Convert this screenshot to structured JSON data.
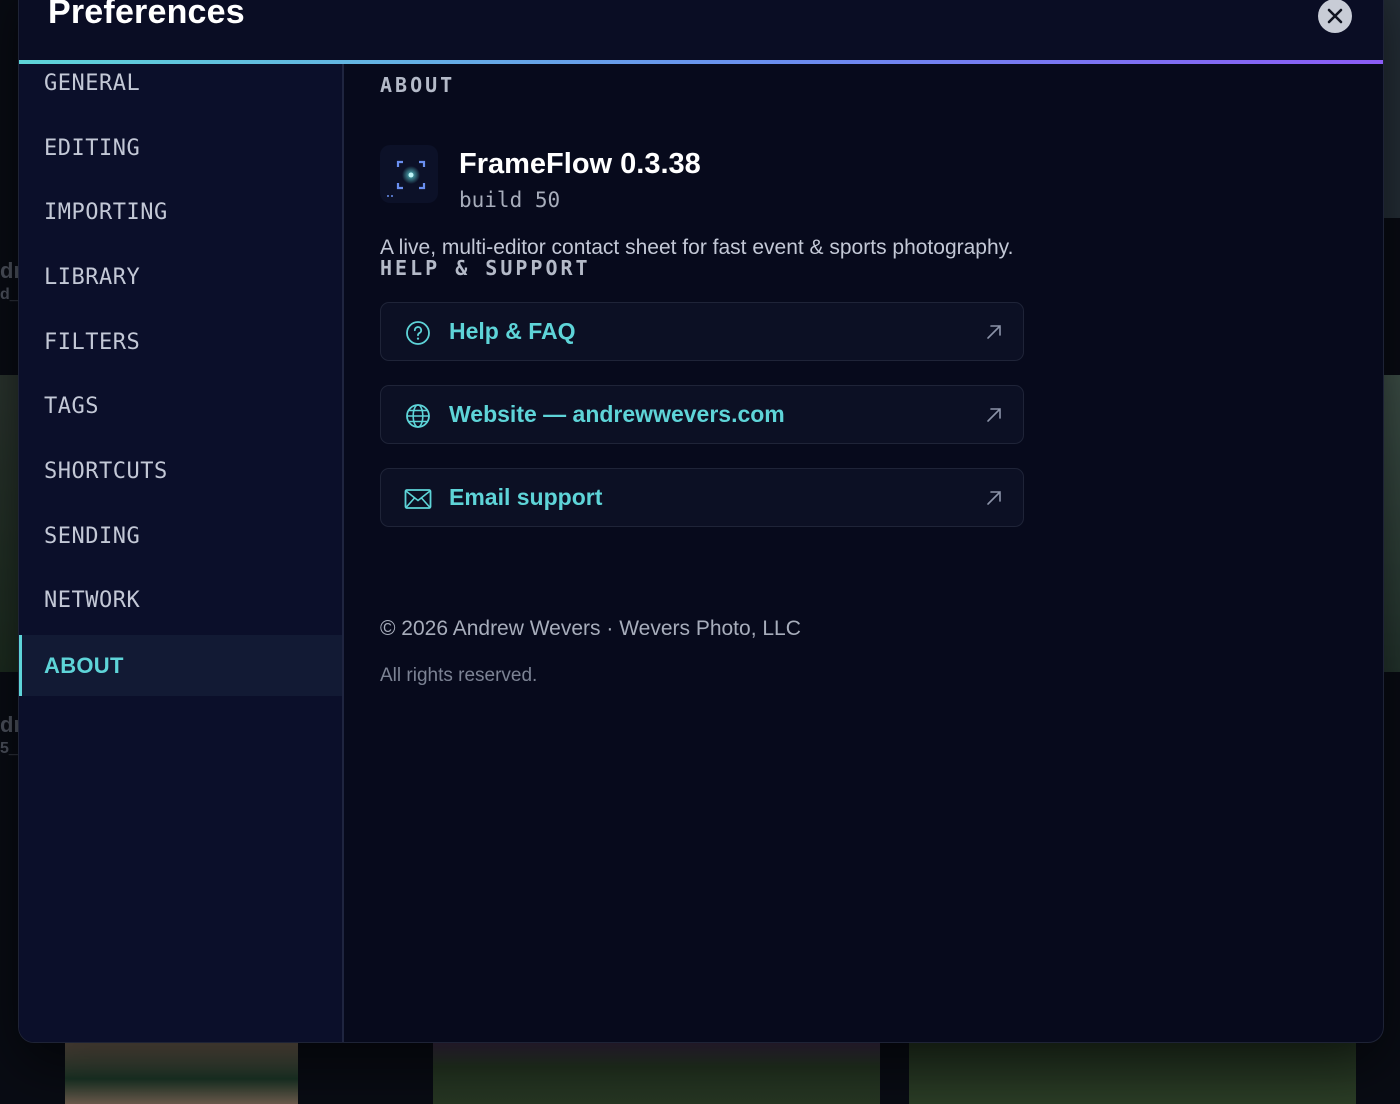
{
  "background": {
    "left_labels": [
      "dr",
      "d_",
      "dr",
      "5_"
    ]
  },
  "modal": {
    "title": "Preferences",
    "close_label": "×"
  },
  "sidebar": {
    "items": [
      {
        "label": "GENERAL"
      },
      {
        "label": "EDITING"
      },
      {
        "label": "IMPORTING"
      },
      {
        "label": "LIBRARY"
      },
      {
        "label": "FILTERS"
      },
      {
        "label": "TAGS"
      },
      {
        "label": "SHORTCUTS"
      },
      {
        "label": "SENDING"
      },
      {
        "label": "NETWORK"
      },
      {
        "label": "ABOUT",
        "active": true
      }
    ]
  },
  "about": {
    "heading": "ABOUT",
    "app_name": "FrameFlow 0.3.38",
    "build": "build 50",
    "description": "A live, multi-editor contact sheet for fast event & sports photography.",
    "icon": "frameflow-logo-icon"
  },
  "help": {
    "heading": "HELP & SUPPORT",
    "links": [
      {
        "label": "Help & FAQ",
        "icon": "question-circle-icon"
      },
      {
        "label": "Website — andrewwevers.com",
        "icon": "globe-icon"
      },
      {
        "label": "Email support",
        "icon": "mail-icon"
      }
    ],
    "external_icon": "external-link-arrow-icon"
  },
  "footer": {
    "copyright": "© 2026 Andrew Wevers · Wevers Photo, LLC",
    "rights": "All rights reserved."
  },
  "colors": {
    "accent": "#5ed4d8",
    "accent_gradient_end": "#8b5cf6",
    "modal_bg": "#070a1c",
    "sidebar_bg": "#0b0f2a"
  }
}
